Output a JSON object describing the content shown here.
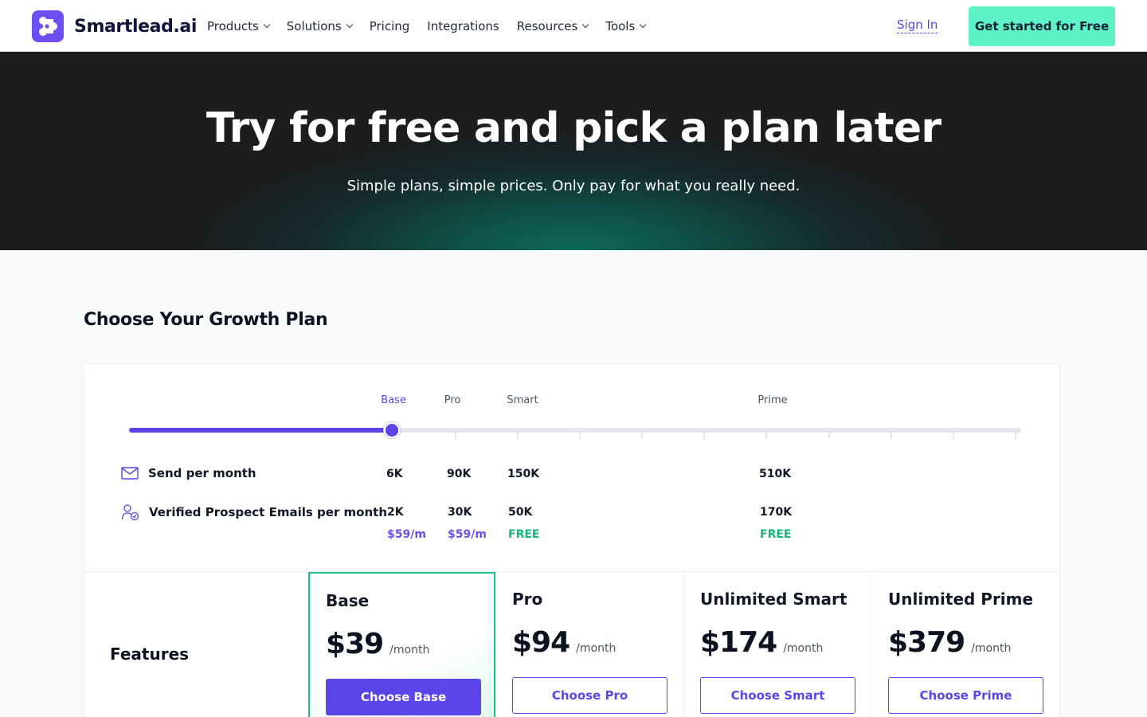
{
  "header": {
    "brand": "Smartlead.ai",
    "nav": [
      {
        "label": "Products",
        "dropdown": true
      },
      {
        "label": "Solutions",
        "dropdown": true
      },
      {
        "label": "Pricing",
        "dropdown": false
      },
      {
        "label": "Integrations",
        "dropdown": false
      },
      {
        "label": "Resources",
        "dropdown": true
      },
      {
        "label": "Tools",
        "dropdown": true
      }
    ],
    "sign_in": "Sign In",
    "cta": "Get started for Free"
  },
  "hero": {
    "title": "Try for free and pick a plan later",
    "subtitle": "Simple plans, simple prices. Only pay for what you really need."
  },
  "growth": {
    "title": "Choose Your Growth Plan",
    "slider": {
      "tiers": [
        "Base",
        "Pro",
        "Smart",
        "Prime"
      ],
      "selected": "Base",
      "value_fraction": 0.295
    },
    "rows": {
      "send_label": "Send per month",
      "send_values": [
        "6K",
        "90K",
        "150K",
        "510K"
      ],
      "verified_label": "Verified Prospect Emails per month",
      "verified_values": [
        "2K",
        "30K",
        "50K",
        "170K"
      ],
      "prices": [
        "$59/m",
        "$59/m",
        "FREE",
        "FREE"
      ]
    }
  },
  "features_label": "Features",
  "plans": [
    {
      "name": "Base",
      "price": "$39",
      "period": "/month",
      "button": "Choose Base"
    },
    {
      "name": "Pro",
      "price": "$94",
      "period": "/month",
      "button": "Choose Pro"
    },
    {
      "name": "Unlimited Smart",
      "price": "$174",
      "period": "/month",
      "button": "Choose Smart"
    },
    {
      "name": "Unlimited Prime",
      "price": "$379",
      "period": "/month",
      "button": "Choose Prime"
    }
  ],
  "colors": {
    "accent": "#5b45e8",
    "cta": "#5ff2c6",
    "free_green": "#14b87f",
    "highlight_border": "#1fbf8f"
  },
  "icons": {
    "envelope": "envelope-icon",
    "verified_user": "user-check-icon",
    "dropdown": "chevron-down-icon"
  }
}
